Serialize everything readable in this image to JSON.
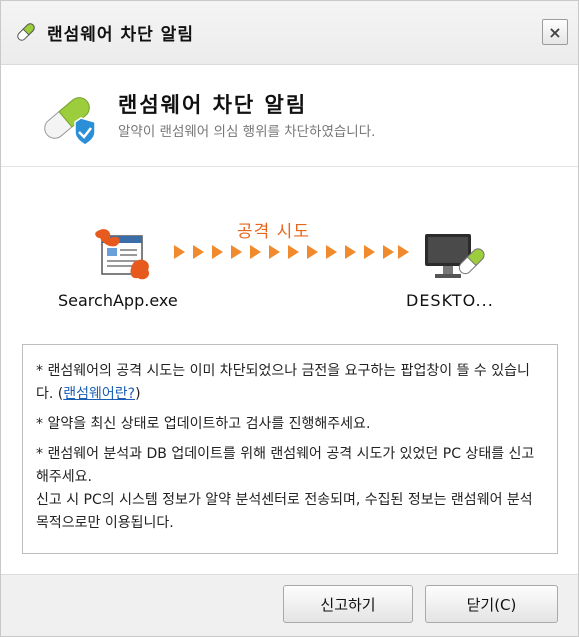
{
  "window": {
    "title": "랜섬웨어 차단 알림",
    "close_symbol": "×"
  },
  "header": {
    "title": "랜섬웨어 차단 알림",
    "subtitle": "알약이 랜섬웨어 의심 행위를 차단하였습니다."
  },
  "attack": {
    "label": "공격 시도",
    "source_name": "SearchApp.exe",
    "target_name": "DESKTO...",
    "source_icon": "infected-app-icon",
    "target_icon": "protected-pc-icon",
    "arrow_color": "#f08a2c"
  },
  "notice": {
    "line1_text": "* 랜섬웨어의 공격 시도는 이미 차단되었으나 금전을 요구하는 팝업창이 뜰 수 있습니다. (",
    "line1_link": "랜섬웨어란?",
    "line1_end": ")",
    "line2": "* 알약을 최신 상태로 업데이트하고 검사를 진행해주세요.",
    "line3": "* 랜섬웨어 분석과 DB 업데이트를 위해 랜섬웨어 공격 시도가 있었던 PC 상태를 신고해주세요.",
    "line4": "신고 시 PC의 시스템 정보가 알약 분석센터로 전송되며, 수집된 정보는 랜섬웨어 분석 목적으로만 이용됩니다."
  },
  "footer": {
    "report_label": "신고하기",
    "close_label": "닫기(C)"
  },
  "colors": {
    "accent_orange": "#e8661c",
    "link_blue": "#1a5fb4",
    "pill_green": "#9ccd3c"
  }
}
